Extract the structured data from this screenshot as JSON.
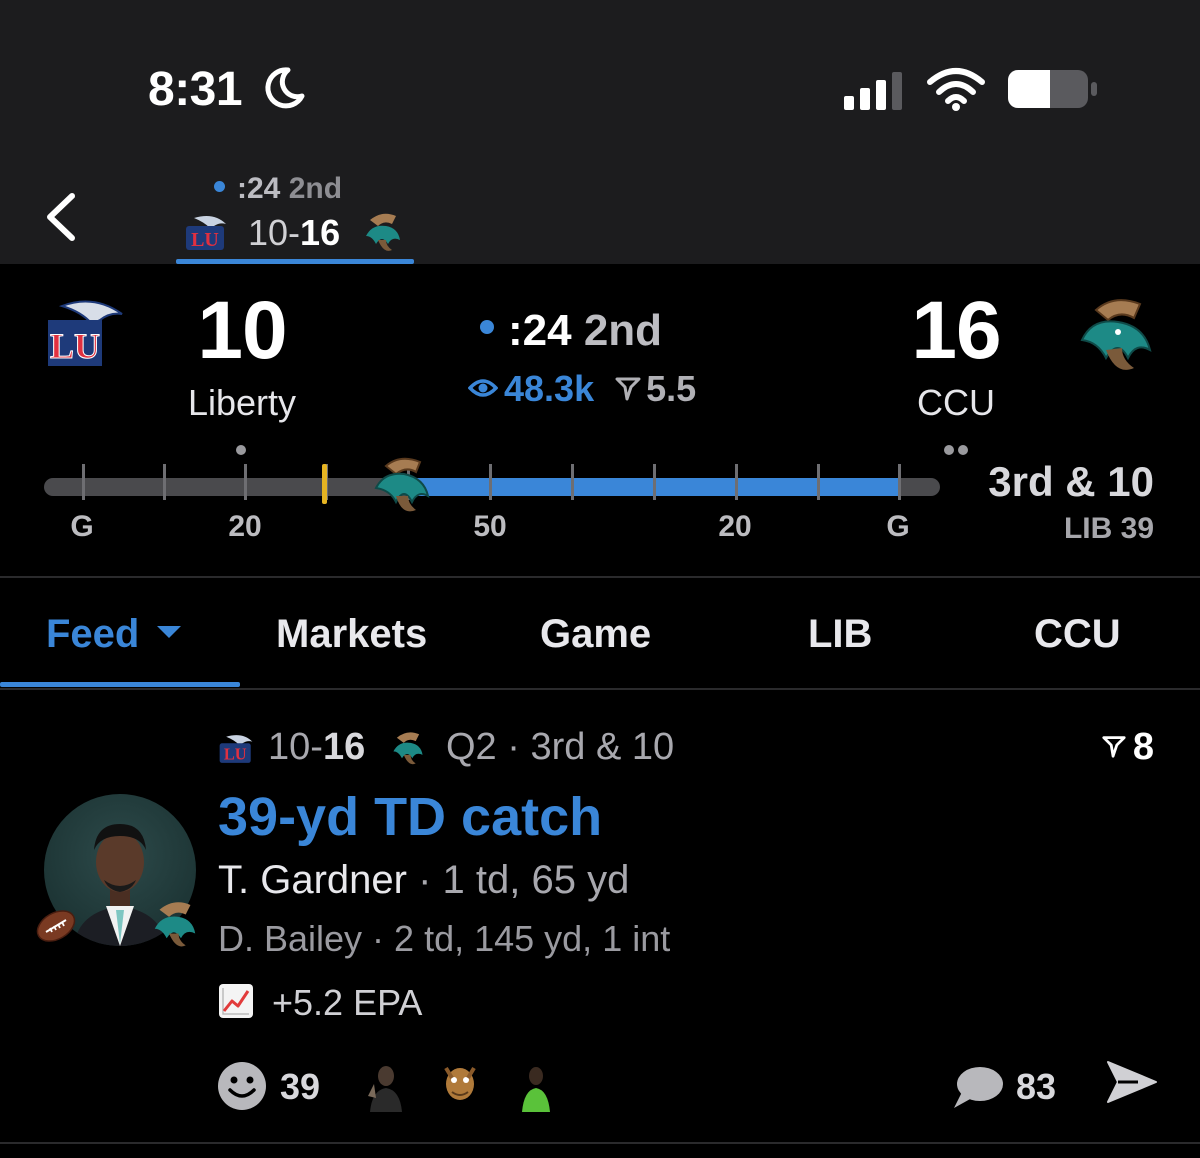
{
  "status_bar": {
    "time": "8:31"
  },
  "nav": {
    "mini_clock": ":24",
    "mini_quarter": "2nd",
    "mini_score_home": "10",
    "mini_score_sep": "-",
    "mini_score_away": "16"
  },
  "scoreboard": {
    "home": {
      "score": "10",
      "name": "Liberty",
      "timeouts": 1
    },
    "away": {
      "score": "16",
      "name": "CCU",
      "timeouts": 2
    },
    "clock": ":24",
    "quarter": "2nd",
    "views": "48.3k",
    "spread": "5.5",
    "down_distance": "3rd & 10",
    "ball_on": "LIB 39",
    "yard_labels": [
      "G",
      "20",
      "50",
      "20",
      "G"
    ]
  },
  "tabs": [
    {
      "label": "Feed"
    },
    {
      "label": "Markets"
    },
    {
      "label": "Game"
    },
    {
      "label": "LIB"
    },
    {
      "label": "CCU"
    }
  ],
  "feed_card": {
    "score_home": "10",
    "score_sep": "-",
    "score_away": "16",
    "situation": "Q2 · 3rd & 10",
    "odds": "8",
    "title": "39-yd TD catch",
    "player1_name": "T. Gardner",
    "player1_sep": " · ",
    "player1_stats": "1 td, 65 yd",
    "player2": "D. Bailey · 2 td, 145 yd, 1 int",
    "epa": "+5.2 EPA",
    "reactions_count": "39",
    "comments_count": "83"
  },
  "colors": {
    "accent": "#3a86d8",
    "first_down_marker": "#e6b422",
    "background": "#000000",
    "header_background": "#1c1c1e"
  },
  "icons": [
    "moon-icon",
    "signal-icon",
    "wifi-icon",
    "battery-icon",
    "back-chevron-icon",
    "eye-icon",
    "spread-flag-icon",
    "football-icon",
    "trend-chart-icon",
    "smile-icon",
    "comment-icon",
    "share-icon"
  ]
}
